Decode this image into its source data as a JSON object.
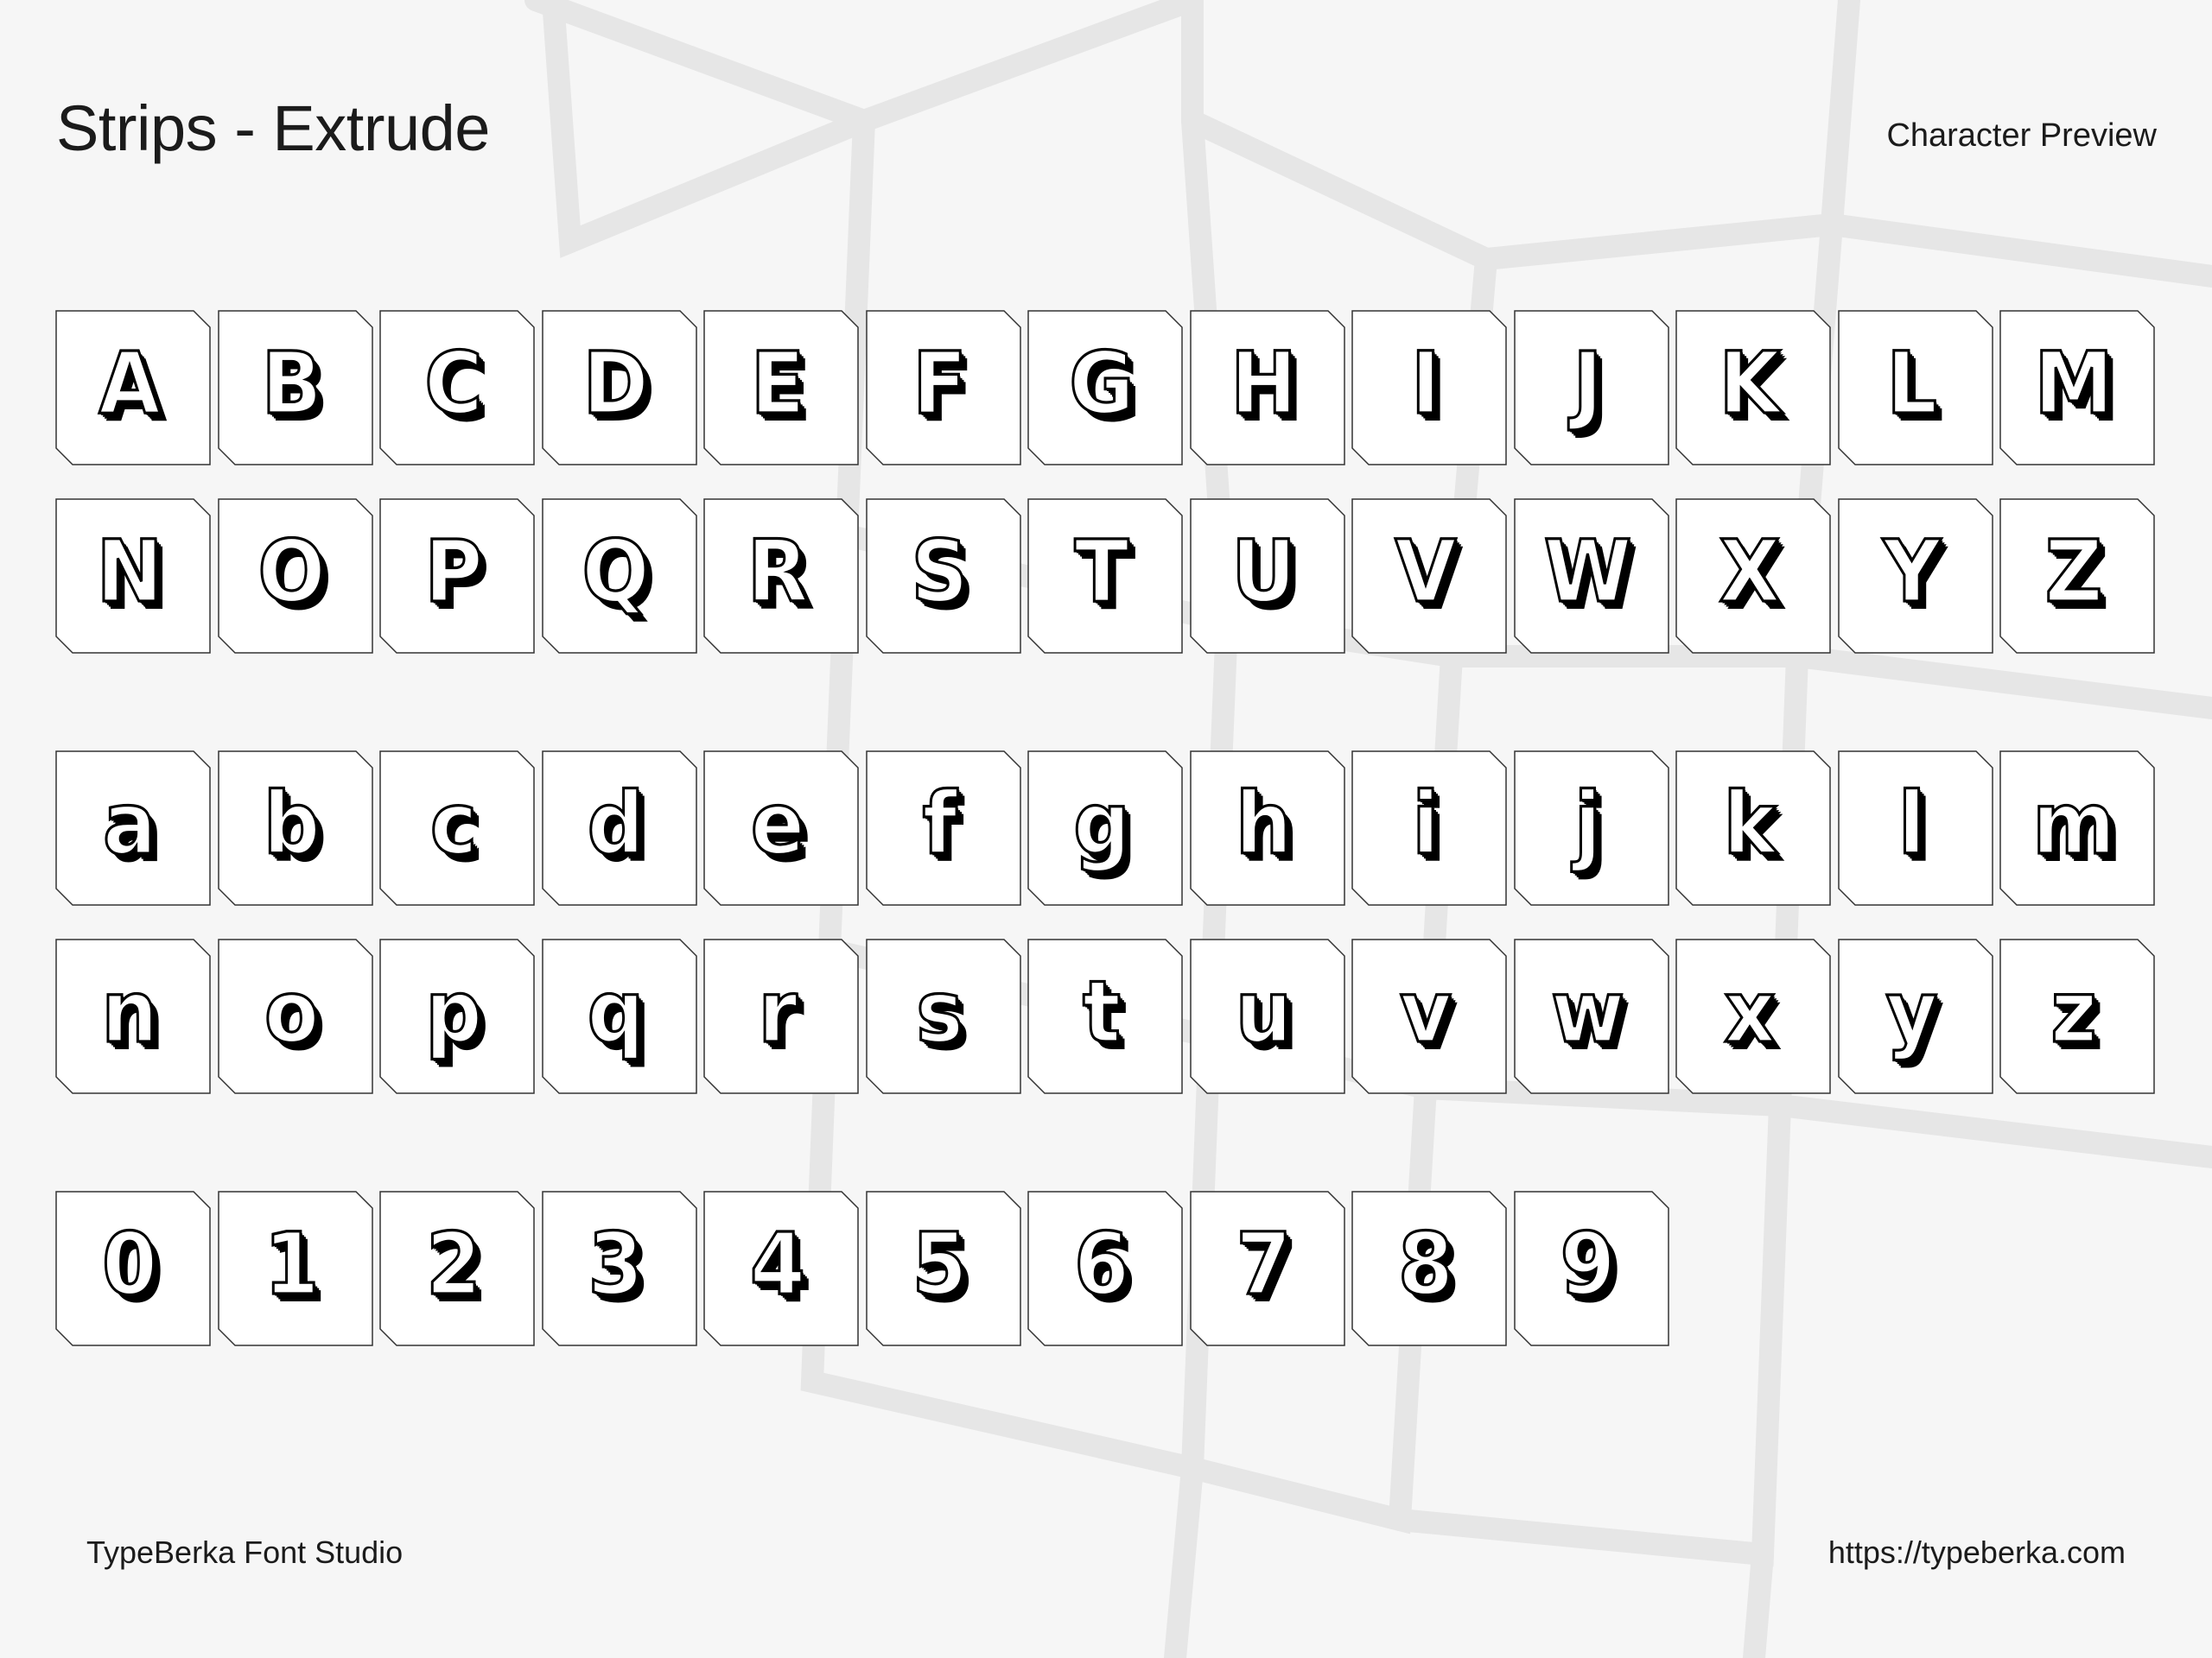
{
  "header": {
    "title": "Strips  - Extrude",
    "subtitle": "Character Preview"
  },
  "sections": {
    "uppercase": [
      "A",
      "B",
      "C",
      "D",
      "E",
      "F",
      "G",
      "H",
      "I",
      "J",
      "K",
      "L",
      "M",
      "N",
      "O",
      "P",
      "Q",
      "R",
      "S",
      "T",
      "U",
      "V",
      "W",
      "X",
      "Y",
      "Z"
    ],
    "lowercase": [
      "a",
      "b",
      "c",
      "d",
      "e",
      "f",
      "g",
      "h",
      "i",
      "j",
      "k",
      "l",
      "m",
      "n",
      "o",
      "p",
      "q",
      "r",
      "s",
      "t",
      "u",
      "v",
      "w",
      "x",
      "y",
      "z"
    ],
    "digits": [
      "0",
      "1",
      "2",
      "3",
      "4",
      "5",
      "6",
      "7",
      "8",
      "9"
    ]
  },
  "footer": {
    "studio": "TypeBerka Font Studio",
    "url": "https://typeberka.com"
  },
  "colors": {
    "background": "#f6f6f6",
    "tile_fill": "#ffffff",
    "tile_border": "#333333",
    "glyph_outline": "#000000",
    "text": "#1b1b1b"
  }
}
